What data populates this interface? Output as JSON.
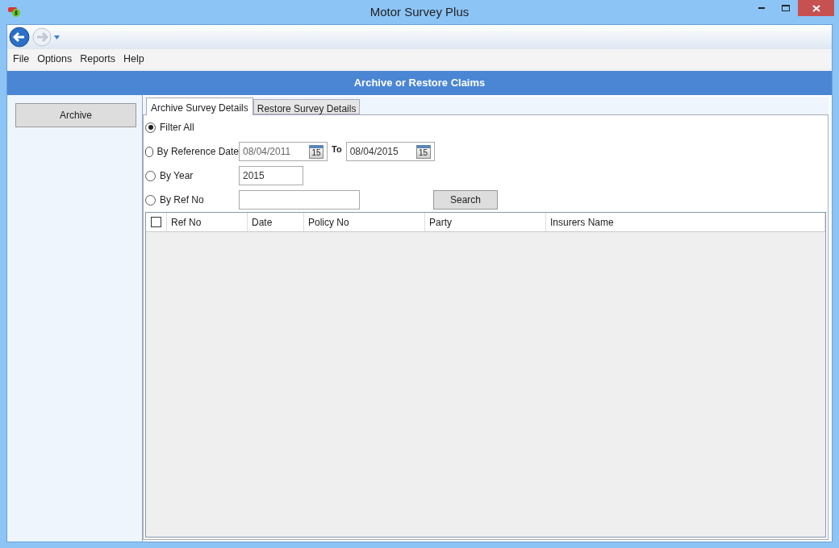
{
  "window": {
    "title": "Motor Survey Plus"
  },
  "menu": [
    "File",
    "Options",
    "Reports",
    "Help"
  ],
  "header": "Archive or Restore Claims",
  "sidebar": {
    "button": "Archive"
  },
  "tabs": [
    {
      "label": "Archive Survey Details",
      "selected": true
    },
    {
      "label": "Restore Survey Details",
      "selected": false
    }
  ],
  "filters": [
    {
      "kind": "plain",
      "label": "Filter All",
      "selected": true
    },
    {
      "kind": "daterange",
      "label": "By Reference Date",
      "from": "08/04/2011",
      "to_label": "To",
      "to": "08/04/2015",
      "from_calendar_day": "15",
      "to_calendar_day": "15",
      "selected": false
    },
    {
      "kind": "text",
      "label": "By Year",
      "value": "2015",
      "selected": false
    },
    {
      "kind": "search",
      "label": "By Ref No",
      "button": "Search",
      "selected": false
    }
  ],
  "table": {
    "select_all_checked": false,
    "columns": [
      "Ref No",
      "Date",
      "Policy No",
      "Party",
      "Insurers Name"
    ]
  }
}
